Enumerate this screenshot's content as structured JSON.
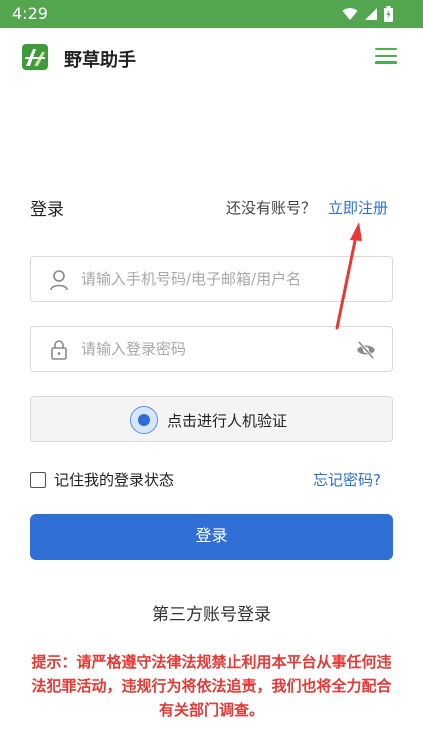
{
  "status_bar": {
    "time": "4:29"
  },
  "app_bar": {
    "title": "野草助手"
  },
  "login": {
    "heading": "登录",
    "no_account_text": "还没有账号？",
    "register_link": "立即注册",
    "username_placeholder": "请输入手机号码/电子邮箱/用户名",
    "password_placeholder": "请输入登录密码",
    "captcha_label": "点击进行人机验证",
    "remember_label": "记住我的登录状态",
    "forgot_link": "忘记密码?",
    "submit_label": "登录",
    "third_party_heading": "第三方账号登录"
  },
  "notice": "提示：请严格遵守法律法规禁止利用本平台从事任何违法犯罪活动，违规行为将依法追责，我们也将全力配合有关部门调查。",
  "colors": {
    "status_bar": "#53a550",
    "accent_blue": "#2f6fd6",
    "link_blue": "#2f6fd1",
    "warning_red": "#e53935",
    "arrow_red": "#e53935",
    "menu_green": "#4caf50"
  },
  "icons": [
    "wifi-icon",
    "signal-icon",
    "battery-icon",
    "app-logo-icon",
    "menu-icon",
    "user-icon",
    "lock-icon",
    "eye-off-icon"
  ]
}
